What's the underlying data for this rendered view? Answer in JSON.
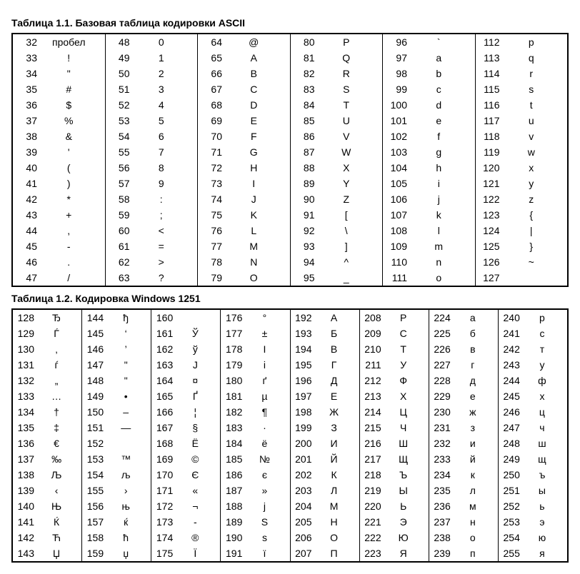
{
  "table1": {
    "title": "Таблица 1.1. Базовая таблица кодировки ASCII"
  },
  "table2": {
    "title": "Таблица 1.2. Кодировка Windows 1251"
  },
  "chart_data": [
    {
      "type": "table",
      "title": "Таблица 1.1. Базовая таблица кодировки ASCII",
      "columns": [
        {
          "start": 32,
          "items": [
            {
              "code": 32,
              "char": "пробел"
            },
            {
              "code": 33,
              "char": "!"
            },
            {
              "code": 34,
              "char": "\""
            },
            {
              "code": 35,
              "char": "#"
            },
            {
              "code": 36,
              "char": "$"
            },
            {
              "code": 37,
              "char": "%"
            },
            {
              "code": 38,
              "char": "&"
            },
            {
              "code": 39,
              "char": "'"
            },
            {
              "code": 40,
              "char": "("
            },
            {
              "code": 41,
              "char": ")"
            },
            {
              "code": 42,
              "char": "*"
            },
            {
              "code": 43,
              "char": "+"
            },
            {
              "code": 44,
              "char": ","
            },
            {
              "code": 45,
              "char": "-"
            },
            {
              "code": 46,
              "char": "."
            },
            {
              "code": 47,
              "char": "/"
            }
          ]
        },
        {
          "start": 48,
          "items": [
            {
              "code": 48,
              "char": "0"
            },
            {
              "code": 49,
              "char": "1"
            },
            {
              "code": 50,
              "char": "2"
            },
            {
              "code": 51,
              "char": "3"
            },
            {
              "code": 52,
              "char": "4"
            },
            {
              "code": 53,
              "char": "5"
            },
            {
              "code": 54,
              "char": "6"
            },
            {
              "code": 55,
              "char": "7"
            },
            {
              "code": 56,
              "char": "8"
            },
            {
              "code": 57,
              "char": "9"
            },
            {
              "code": 58,
              "char": ":"
            },
            {
              "code": 59,
              "char": ";"
            },
            {
              "code": 60,
              "char": "<"
            },
            {
              "code": 61,
              "char": "="
            },
            {
              "code": 62,
              "char": ">"
            },
            {
              "code": 63,
              "char": "?"
            }
          ]
        },
        {
          "start": 64,
          "items": [
            {
              "code": 64,
              "char": "@"
            },
            {
              "code": 65,
              "char": "A"
            },
            {
              "code": 66,
              "char": "B"
            },
            {
              "code": 67,
              "char": "C"
            },
            {
              "code": 68,
              "char": "D"
            },
            {
              "code": 69,
              "char": "E"
            },
            {
              "code": 70,
              "char": "F"
            },
            {
              "code": 71,
              "char": "G"
            },
            {
              "code": 72,
              "char": "H"
            },
            {
              "code": 73,
              "char": "I"
            },
            {
              "code": 74,
              "char": "J"
            },
            {
              "code": 75,
              "char": "K"
            },
            {
              "code": 76,
              "char": "L"
            },
            {
              "code": 77,
              "char": "M"
            },
            {
              "code": 78,
              "char": "N"
            },
            {
              "code": 79,
              "char": "O"
            }
          ]
        },
        {
          "start": 80,
          "items": [
            {
              "code": 80,
              "char": "P"
            },
            {
              "code": 81,
              "char": "Q"
            },
            {
              "code": 82,
              "char": "R"
            },
            {
              "code": 83,
              "char": "S"
            },
            {
              "code": 84,
              "char": "T"
            },
            {
              "code": 85,
              "char": "U"
            },
            {
              "code": 86,
              "char": "V"
            },
            {
              "code": 87,
              "char": "W"
            },
            {
              "code": 88,
              "char": "X"
            },
            {
              "code": 89,
              "char": "Y"
            },
            {
              "code": 90,
              "char": "Z"
            },
            {
              "code": 91,
              "char": "["
            },
            {
              "code": 92,
              "char": "\\"
            },
            {
              "code": 93,
              "char": "]"
            },
            {
              "code": 94,
              "char": "^"
            },
            {
              "code": 95,
              "char": "_"
            }
          ]
        },
        {
          "start": 96,
          "items": [
            {
              "code": 96,
              "char": "`"
            },
            {
              "code": 97,
              "char": "a"
            },
            {
              "code": 98,
              "char": "b"
            },
            {
              "code": 99,
              "char": "c"
            },
            {
              "code": 100,
              "char": "d"
            },
            {
              "code": 101,
              "char": "e"
            },
            {
              "code": 102,
              "char": "f"
            },
            {
              "code": 103,
              "char": "g"
            },
            {
              "code": 104,
              "char": "h"
            },
            {
              "code": 105,
              "char": "i"
            },
            {
              "code": 106,
              "char": "j"
            },
            {
              "code": 107,
              "char": "k"
            },
            {
              "code": 108,
              "char": "l"
            },
            {
              "code": 109,
              "char": "m"
            },
            {
              "code": 110,
              "char": "n"
            },
            {
              "code": 111,
              "char": "o"
            }
          ]
        },
        {
          "start": 112,
          "items": [
            {
              "code": 112,
              "char": "p"
            },
            {
              "code": 113,
              "char": "q"
            },
            {
              "code": 114,
              "char": "r"
            },
            {
              "code": 115,
              "char": "s"
            },
            {
              "code": 116,
              "char": "t"
            },
            {
              "code": 117,
              "char": "u"
            },
            {
              "code": 118,
              "char": "v"
            },
            {
              "code": 119,
              "char": "w"
            },
            {
              "code": 120,
              "char": "x"
            },
            {
              "code": 121,
              "char": "y"
            },
            {
              "code": 122,
              "char": "z"
            },
            {
              "code": 123,
              "char": "{"
            },
            {
              "code": 124,
              "char": "|"
            },
            {
              "code": 125,
              "char": "}"
            },
            {
              "code": 126,
              "char": "~"
            },
            {
              "code": 127,
              "char": ""
            }
          ]
        }
      ]
    },
    {
      "type": "table",
      "title": "Таблица 1.2. Кодировка Windows 1251",
      "columns": [
        {
          "start": 128,
          "items": [
            {
              "code": 128,
              "char": "Ђ"
            },
            {
              "code": 129,
              "char": "Ѓ"
            },
            {
              "code": 130,
              "char": "‚"
            },
            {
              "code": 131,
              "char": "ѓ"
            },
            {
              "code": 132,
              "char": "„"
            },
            {
              "code": 133,
              "char": "…"
            },
            {
              "code": 134,
              "char": "†"
            },
            {
              "code": 135,
              "char": "‡"
            },
            {
              "code": 136,
              "char": "€"
            },
            {
              "code": 137,
              "char": "‰"
            },
            {
              "code": 138,
              "char": "Љ"
            },
            {
              "code": 139,
              "char": "‹"
            },
            {
              "code": 140,
              "char": "Њ"
            },
            {
              "code": 141,
              "char": "Ќ"
            },
            {
              "code": 142,
              "char": "Ћ"
            },
            {
              "code": 143,
              "char": "Џ"
            }
          ]
        },
        {
          "start": 144,
          "items": [
            {
              "code": 144,
              "char": "ђ"
            },
            {
              "code": 145,
              "char": "‘"
            },
            {
              "code": 146,
              "char": "’"
            },
            {
              "code": 147,
              "char": "\""
            },
            {
              "code": 148,
              "char": "\""
            },
            {
              "code": 149,
              "char": "•"
            },
            {
              "code": 150,
              "char": "–"
            },
            {
              "code": 151,
              "char": "—"
            },
            {
              "code": 152,
              "char": ""
            },
            {
              "code": 153,
              "char": "™"
            },
            {
              "code": 154,
              "char": "љ"
            },
            {
              "code": 155,
              "char": "›"
            },
            {
              "code": 156,
              "char": "њ"
            },
            {
              "code": 157,
              "char": "ќ"
            },
            {
              "code": 158,
              "char": "ћ"
            },
            {
              "code": 159,
              "char": "џ"
            }
          ]
        },
        {
          "start": 160,
          "items": [
            {
              "code": 160,
              "char": " "
            },
            {
              "code": 161,
              "char": "Ў"
            },
            {
              "code": 162,
              "char": "ў"
            },
            {
              "code": 163,
              "char": "Ј"
            },
            {
              "code": 164,
              "char": "¤"
            },
            {
              "code": 165,
              "char": "Ґ"
            },
            {
              "code": 166,
              "char": "¦"
            },
            {
              "code": 167,
              "char": "§"
            },
            {
              "code": 168,
              "char": "Ё"
            },
            {
              "code": 169,
              "char": "©"
            },
            {
              "code": 170,
              "char": "Є"
            },
            {
              "code": 171,
              "char": "«"
            },
            {
              "code": 172,
              "char": "¬"
            },
            {
              "code": 173,
              "char": "-"
            },
            {
              "code": 174,
              "char": "®"
            },
            {
              "code": 175,
              "char": "Ї"
            }
          ]
        },
        {
          "start": 176,
          "items": [
            {
              "code": 176,
              "char": "°"
            },
            {
              "code": 177,
              "char": "±"
            },
            {
              "code": 178,
              "char": "І"
            },
            {
              "code": 179,
              "char": "і"
            },
            {
              "code": 180,
              "char": "ґ"
            },
            {
              "code": 181,
              "char": "µ"
            },
            {
              "code": 182,
              "char": "¶"
            },
            {
              "code": 183,
              "char": "·"
            },
            {
              "code": 184,
              "char": "ё"
            },
            {
              "code": 185,
              "char": "№"
            },
            {
              "code": 186,
              "char": "є"
            },
            {
              "code": 187,
              "char": "»"
            },
            {
              "code": 188,
              "char": "ј"
            },
            {
              "code": 189,
              "char": "Ѕ"
            },
            {
              "code": 190,
              "char": "ѕ"
            },
            {
              "code": 191,
              "char": "ї"
            }
          ]
        },
        {
          "start": 192,
          "items": [
            {
              "code": 192,
              "char": "А"
            },
            {
              "code": 193,
              "char": "Б"
            },
            {
              "code": 194,
              "char": "В"
            },
            {
              "code": 195,
              "char": "Г"
            },
            {
              "code": 196,
              "char": "Д"
            },
            {
              "code": 197,
              "char": "Е"
            },
            {
              "code": 198,
              "char": "Ж"
            },
            {
              "code": 199,
              "char": "З"
            },
            {
              "code": 200,
              "char": "И"
            },
            {
              "code": 201,
              "char": "Й"
            },
            {
              "code": 202,
              "char": "К"
            },
            {
              "code": 203,
              "char": "Л"
            },
            {
              "code": 204,
              "char": "М"
            },
            {
              "code": 205,
              "char": "Н"
            },
            {
              "code": 206,
              "char": "О"
            },
            {
              "code": 207,
              "char": "П"
            }
          ]
        },
        {
          "start": 208,
          "items": [
            {
              "code": 208,
              "char": "Р"
            },
            {
              "code": 209,
              "char": "С"
            },
            {
              "code": 210,
              "char": "Т"
            },
            {
              "code": 211,
              "char": "У"
            },
            {
              "code": 212,
              "char": "Ф"
            },
            {
              "code": 213,
              "char": "Х"
            },
            {
              "code": 214,
              "char": "Ц"
            },
            {
              "code": 215,
              "char": "Ч"
            },
            {
              "code": 216,
              "char": "Ш"
            },
            {
              "code": 217,
              "char": "Щ"
            },
            {
              "code": 218,
              "char": "Ъ"
            },
            {
              "code": 219,
              "char": "Ы"
            },
            {
              "code": 220,
              "char": "Ь"
            },
            {
              "code": 221,
              "char": "Э"
            },
            {
              "code": 222,
              "char": "Ю"
            },
            {
              "code": 223,
              "char": "Я"
            }
          ]
        },
        {
          "start": 224,
          "items": [
            {
              "code": 224,
              "char": "а"
            },
            {
              "code": 225,
              "char": "б"
            },
            {
              "code": 226,
              "char": "в"
            },
            {
              "code": 227,
              "char": "г"
            },
            {
              "code": 228,
              "char": "д"
            },
            {
              "code": 229,
              "char": "е"
            },
            {
              "code": 230,
              "char": "ж"
            },
            {
              "code": 231,
              "char": "з"
            },
            {
              "code": 232,
              "char": "и"
            },
            {
              "code": 233,
              "char": "й"
            },
            {
              "code": 234,
              "char": "к"
            },
            {
              "code": 235,
              "char": "л"
            },
            {
              "code": 236,
              "char": "м"
            },
            {
              "code": 237,
              "char": "н"
            },
            {
              "code": 238,
              "char": "о"
            },
            {
              "code": 239,
              "char": "п"
            }
          ]
        },
        {
          "start": 240,
          "items": [
            {
              "code": 240,
              "char": "р"
            },
            {
              "code": 241,
              "char": "с"
            },
            {
              "code": 242,
              "char": "т"
            },
            {
              "code": 243,
              "char": "у"
            },
            {
              "code": 244,
              "char": "ф"
            },
            {
              "code": 245,
              "char": "х"
            },
            {
              "code": 246,
              "char": "ц"
            },
            {
              "code": 247,
              "char": "ч"
            },
            {
              "code": 248,
              "char": "ш"
            },
            {
              "code": 249,
              "char": "щ"
            },
            {
              "code": 250,
              "char": "ъ"
            },
            {
              "code": 251,
              "char": "ы"
            },
            {
              "code": 252,
              "char": "ь"
            },
            {
              "code": 253,
              "char": "э"
            },
            {
              "code": 254,
              "char": "ю"
            },
            {
              "code": 255,
              "char": "я"
            }
          ]
        }
      ]
    }
  ]
}
